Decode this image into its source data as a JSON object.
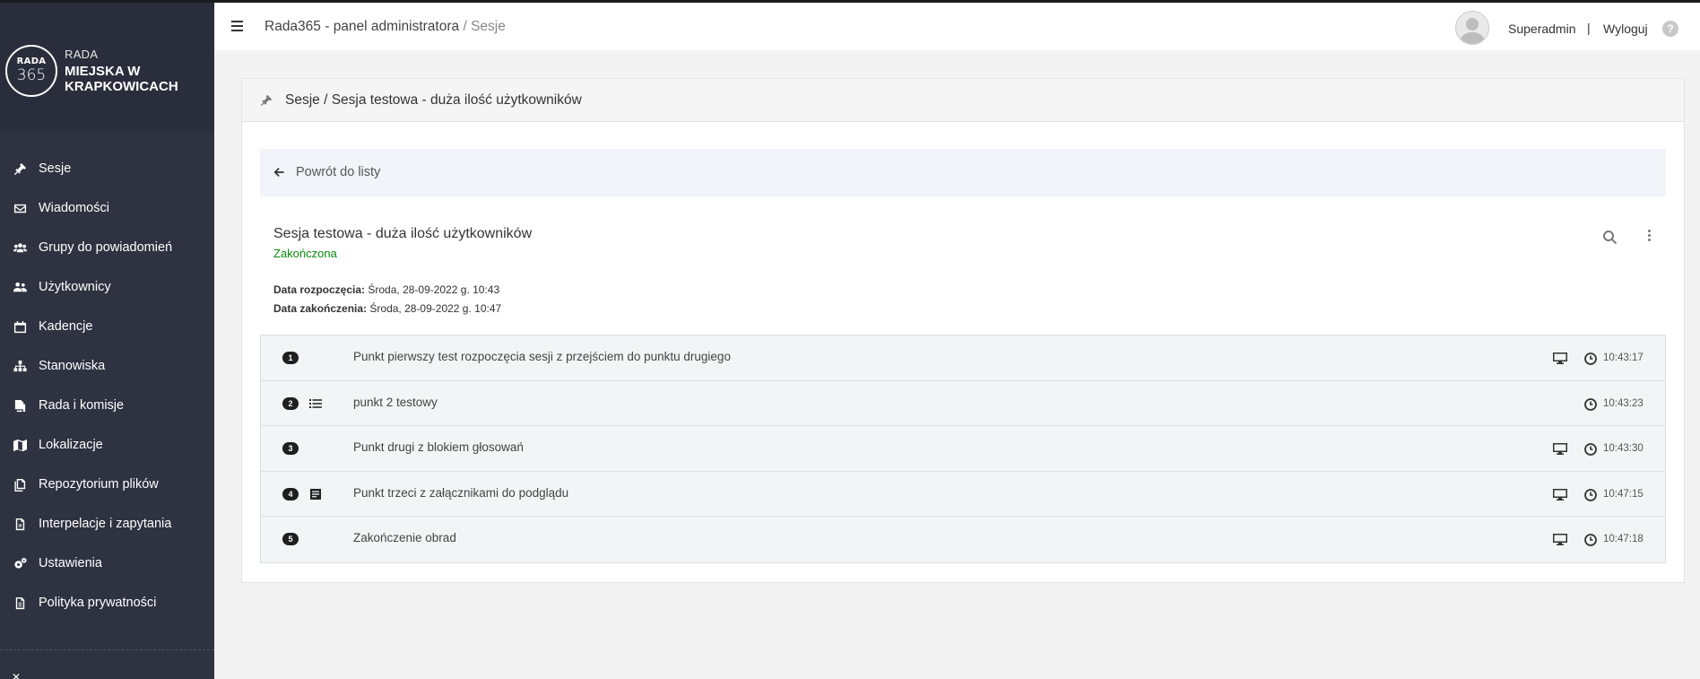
{
  "app": {
    "title": "Rada365 - panel administratora",
    "breadcrumb_sep": "/",
    "breadcrumb_current": "Sesje"
  },
  "logo": {
    "circle_top": "RADA",
    "circle_bottom": "365",
    "line1": "RADA",
    "line2": "MIEJSKA W KRAPKOWICACH"
  },
  "sidebar": {
    "items": [
      {
        "label": "Sesje",
        "icon": "gavel-icon"
      },
      {
        "label": "Wiadomości",
        "icon": "envelope-icon"
      },
      {
        "label": "Grupy do powiadomień",
        "icon": "users-group-icon"
      },
      {
        "label": "Użytkownicy",
        "icon": "users-icon"
      },
      {
        "label": "Kadencje",
        "icon": "calendar-icon"
      },
      {
        "label": "Stanowiska",
        "icon": "sitemap-icon"
      },
      {
        "label": "Rada i komisje",
        "icon": "copy-icon"
      },
      {
        "label": "Lokalizacje",
        "icon": "map-icon"
      },
      {
        "label": "Repozytorium plików",
        "icon": "files-icon"
      },
      {
        "label": "Interpelacje i zapytania",
        "icon": "document-icon"
      },
      {
        "label": "Ustawienia",
        "icon": "cogs-icon"
      },
      {
        "label": "Polityka prywatności",
        "icon": "file-text-icon"
      }
    ]
  },
  "user": {
    "name": "Superadmin",
    "separator": "|",
    "logout": "Wyloguj",
    "help": "?"
  },
  "card": {
    "header": "Sesje / Sesja testowa - duża ilość użytkowników",
    "back_label": "Powrót do listy"
  },
  "session": {
    "title": "Sesja testowa - duża ilość użytkowników",
    "status": "Zakończona",
    "status_color": "#0a8a0a",
    "start_label": "Data rozpoczęcia:",
    "start_value": "Środa, 28-09-2022 g. 10:43",
    "end_label": "Data zakończenia:",
    "end_value": "Środa, 28-09-2022 g. 10:47"
  },
  "agenda": [
    {
      "num": "1",
      "type_icon": "",
      "text": "Punkt pierwszy test rozpoczęcia sesji z przejściem do punktu drugiego",
      "monitor": true,
      "time": "10:43:17"
    },
    {
      "num": "2",
      "type_icon": "list-icon",
      "text": "punkt 2 testowy",
      "monitor": false,
      "time": "10:43:23"
    },
    {
      "num": "3",
      "type_icon": "",
      "text": "Punkt drugi z blokiem głosowań",
      "monitor": true,
      "time": "10:43:30"
    },
    {
      "num": "4",
      "type_icon": "attachment-doc-icon",
      "text": "Punkt trzeci z załącznikami do podglądu",
      "monitor": true,
      "time": "10:47:15"
    },
    {
      "num": "5",
      "type_icon": "",
      "text": "Zakończenie obrad",
      "monitor": true,
      "time": "10:47:18"
    }
  ]
}
